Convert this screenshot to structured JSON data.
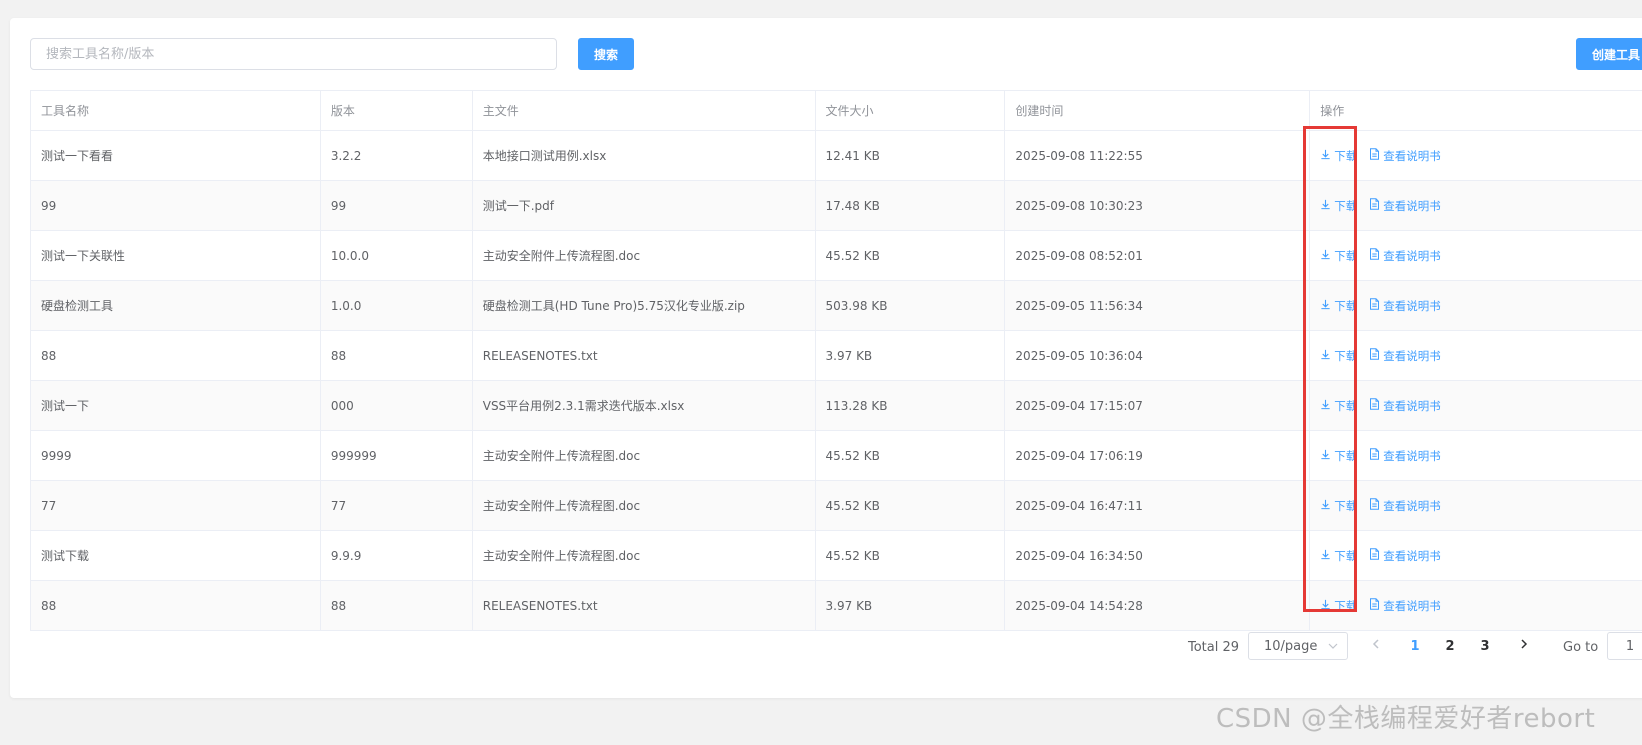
{
  "search": {
    "placeholder": "搜索工具名称/版本",
    "button_label": "搜索"
  },
  "toolbar": {
    "create_label": "创建工具"
  },
  "table": {
    "columns": [
      "工具名称",
      "版本",
      "主文件",
      "文件大小",
      "创建时间",
      "操作"
    ],
    "rows": [
      {
        "name": "测试一下看看",
        "version": "3.2.2",
        "file": "本地接口测试用例.xlsx",
        "size": "12.41 KB",
        "created": "2025-09-08 11:22:55"
      },
      {
        "name": "99",
        "version": "99",
        "file": "测试一下.pdf",
        "size": "17.48 KB",
        "created": "2025-09-08 10:30:23"
      },
      {
        "name": "测试一下关联性",
        "version": "10.0.0",
        "file": "主动安全附件上传流程图.doc",
        "size": "45.52 KB",
        "created": "2025-09-08 08:52:01"
      },
      {
        "name": "硬盘检测工具",
        "version": "1.0.0",
        "file": "硬盘检测工具(HD Tune Pro)5.75汉化专业版.zip",
        "size": "503.98 KB",
        "created": "2025-09-05 11:56:34"
      },
      {
        "name": "88",
        "version": "88",
        "file": "RELEASENOTES.txt",
        "size": "3.97 KB",
        "created": "2025-09-05 10:36:04"
      },
      {
        "name": "测试一下",
        "version": "000",
        "file": "VSS平台用例2.3.1需求迭代版本.xlsx",
        "size": "113.28 KB",
        "created": "2025-09-04 17:15:07"
      },
      {
        "name": "9999",
        "version": "999999",
        "file": "主动安全附件上传流程图.doc",
        "size": "45.52 KB",
        "created": "2025-09-04 17:06:19"
      },
      {
        "name": "77",
        "version": "77",
        "file": "主动安全附件上传流程图.doc",
        "size": "45.52 KB",
        "created": "2025-09-04 16:47:11"
      },
      {
        "name": "测试下载",
        "version": "9.9.9",
        "file": "主动安全附件上传流程图.doc",
        "size": "45.52 KB",
        "created": "2025-09-04 16:34:50"
      },
      {
        "name": "88",
        "version": "88",
        "file": "RELEASENOTES.txt",
        "size": "3.97 KB",
        "created": "2025-09-04 14:54:28"
      }
    ],
    "actions": {
      "download_label": "下载",
      "manual_label": "查看说明书",
      "download_icon": "download-icon",
      "manual_icon": "document-icon"
    }
  },
  "pagination": {
    "total_label": "Total 29",
    "page_size_label": "10/page",
    "pages": [
      "1",
      "2",
      "3"
    ],
    "current_page": "1",
    "goto_label": "Go to",
    "goto_value": "1"
  },
  "watermark": "CSDN @全栈编程爱好者rebort",
  "colors": {
    "primary": "#409eff",
    "highlight": "#e53935"
  }
}
